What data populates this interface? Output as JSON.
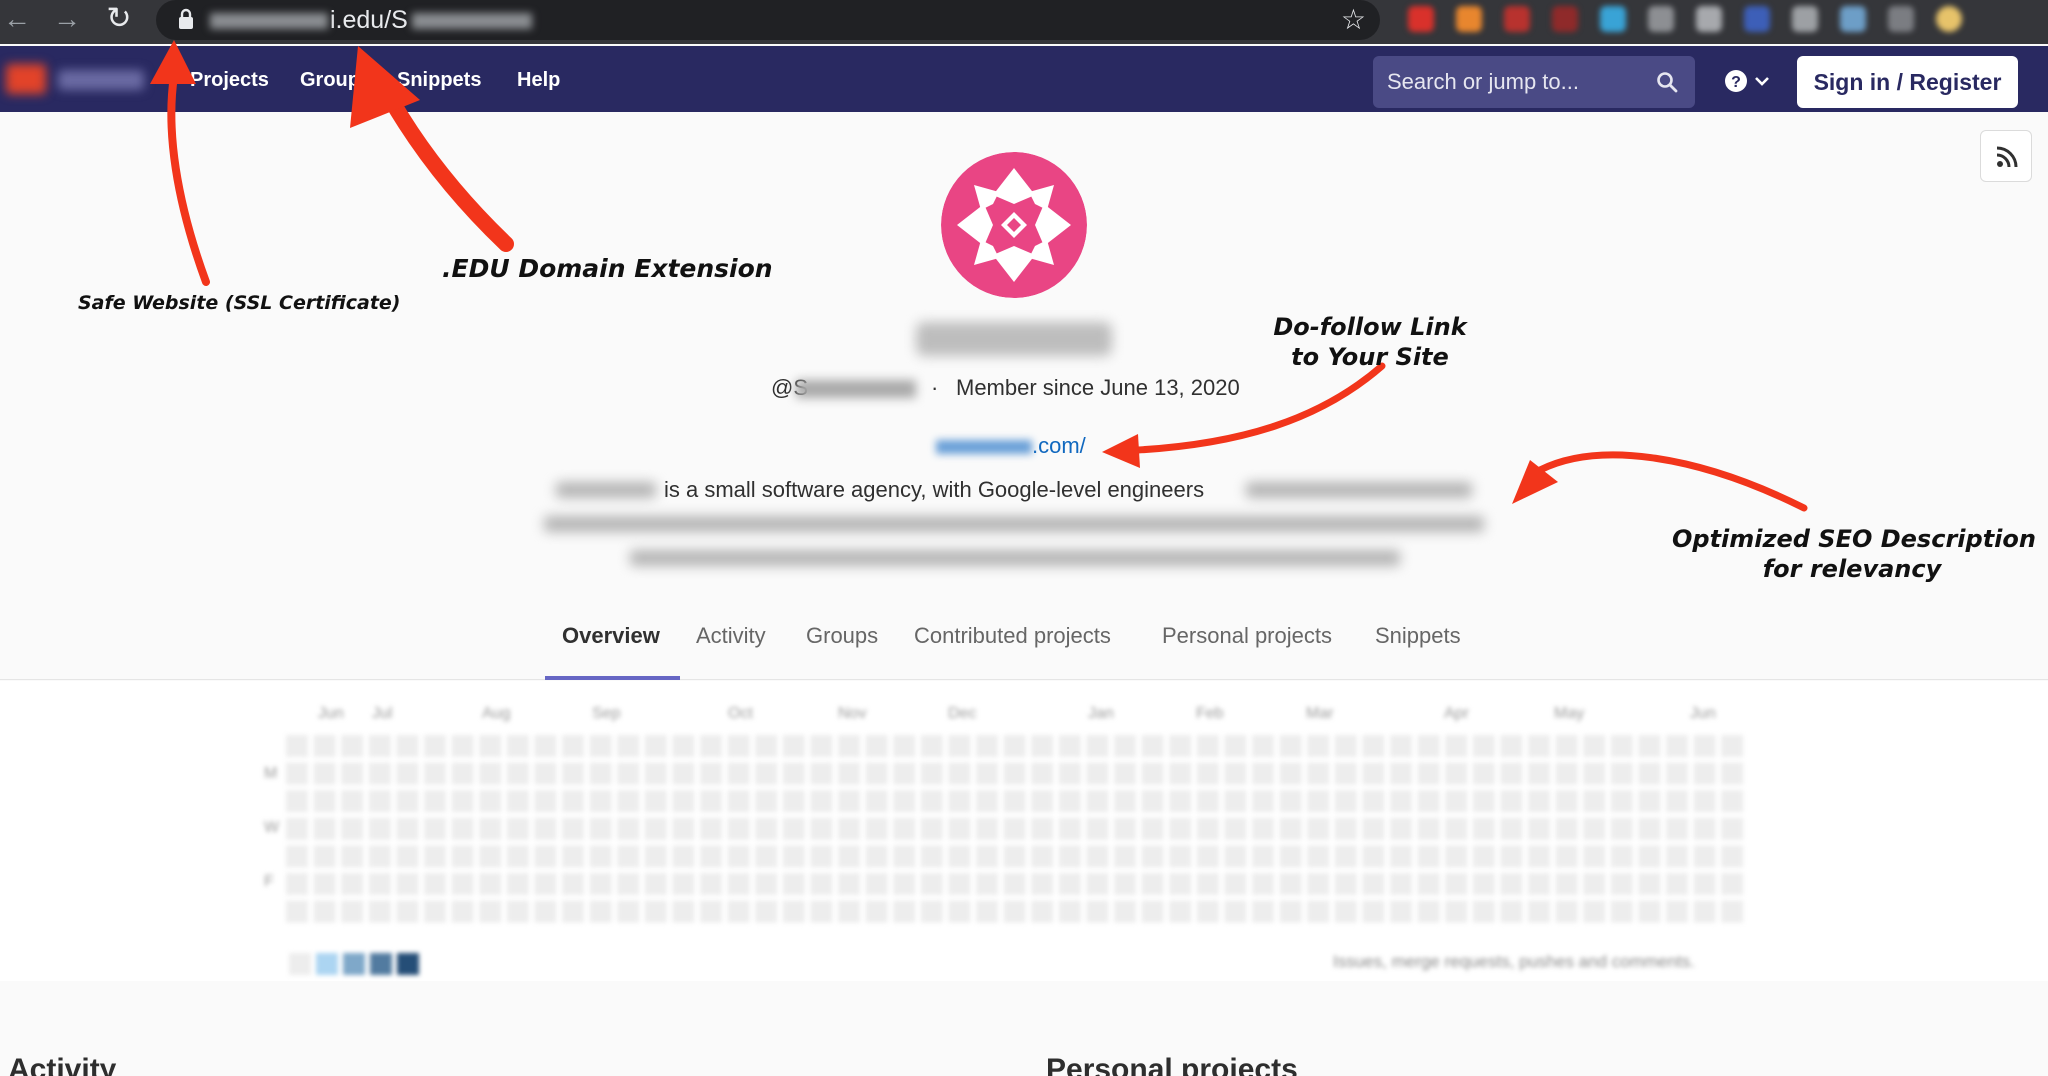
{
  "browser": {
    "url_domain_visible": "i.edu/",
    "url_tail_visible": "S"
  },
  "header": {
    "nav": [
      "Projects",
      "Groups",
      "Snippets",
      "Help"
    ],
    "search_placeholder": "Search or jump to...",
    "signin_label": "Sign in / Register"
  },
  "profile": {
    "handle_prefix": "@S",
    "separator": "·",
    "member_since": "Member since June 13, 2020",
    "website_suffix": ".com/",
    "bio_visible": "is a small software agency, with Google-level engineers",
    "tabs": [
      "Overview",
      "Activity",
      "Groups",
      "Contributed projects",
      "Personal projects",
      "Snippets"
    ],
    "active_tab": 0
  },
  "calendar": {
    "months": [
      "Jun",
      "Jul",
      "Aug",
      "Sep",
      "Oct",
      "Nov",
      "Dec",
      "Jan",
      "Feb",
      "Mar",
      "Apr",
      "May",
      "Jun"
    ],
    "day_labels": [
      "M",
      "W",
      "F"
    ],
    "legend_colors": [
      "#ededed",
      "#acd5f2",
      "#7fa8c9",
      "#527ba0",
      "#254e77"
    ],
    "legend_text": "Issues, merge requests, pushes and comments."
  },
  "sections": {
    "activity_title": "Activity",
    "personal_projects_title": "Personal projects"
  },
  "annotations": {
    "ssl": "Safe Website (SSL Certificate)",
    "edu": ".EDU Domain Extension",
    "dofollow_line1": "Do-follow Link",
    "dofollow_line2": "to Your Site",
    "seo_line1": "Optimized SEO Description",
    "seo_line2": "for relevancy",
    "arrow_color": "#f2351b"
  }
}
